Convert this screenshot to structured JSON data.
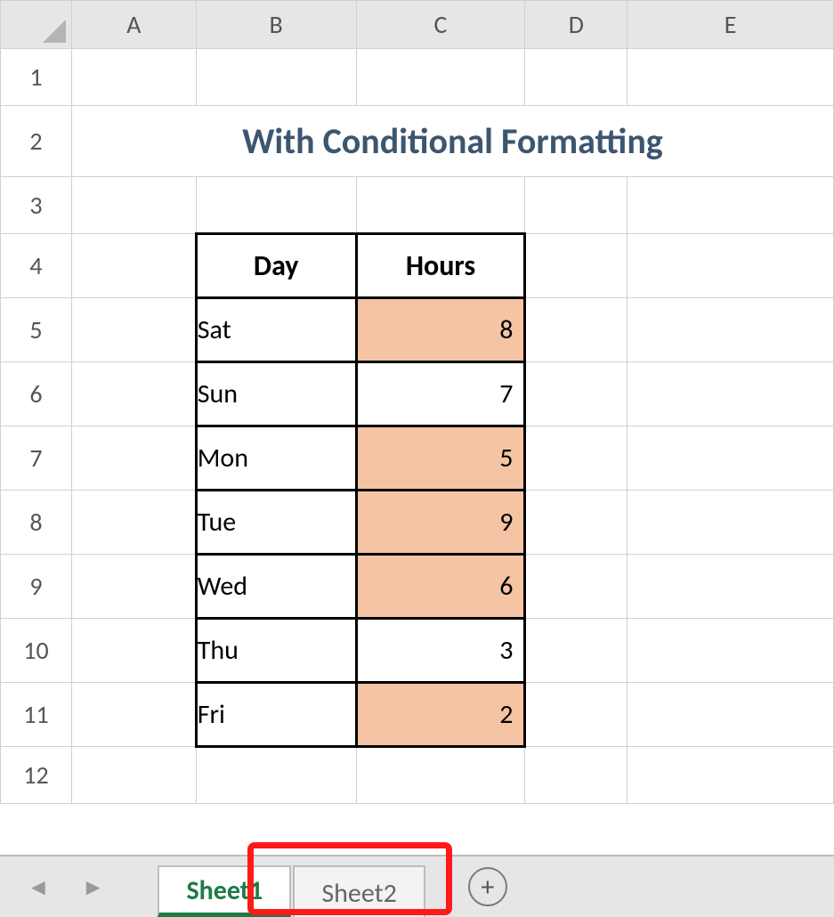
{
  "columns": [
    "A",
    "B",
    "C",
    "D",
    "E"
  ],
  "rows": [
    "1",
    "2",
    "3",
    "4",
    "5",
    "6",
    "7",
    "8",
    "9",
    "10",
    "11",
    "12"
  ],
  "title": "With Conditional Formatting",
  "table": {
    "headers": {
      "day": "Day",
      "hours": "Hours"
    },
    "rows": [
      {
        "day": "Sat",
        "hours": "8",
        "highlight": true
      },
      {
        "day": "Sun",
        "hours": "7",
        "highlight": false
      },
      {
        "day": "Mon",
        "hours": "5",
        "highlight": true
      },
      {
        "day": "Tue",
        "hours": "9",
        "highlight": true
      },
      {
        "day": "Wed",
        "hours": "6",
        "highlight": true
      },
      {
        "day": "Thu",
        "hours": "3",
        "highlight": false
      },
      {
        "day": "Fri",
        "hours": "2",
        "highlight": true
      }
    ]
  },
  "tabs": {
    "active": "Sheet1",
    "inactive": "Sheet2"
  },
  "colors": {
    "highlight_fill": "#f4c4a4",
    "title_text": "#3c566f",
    "title_underline": "#9db3d9",
    "active_tab": "#1e7a47",
    "callout": "#ff1a1a"
  }
}
